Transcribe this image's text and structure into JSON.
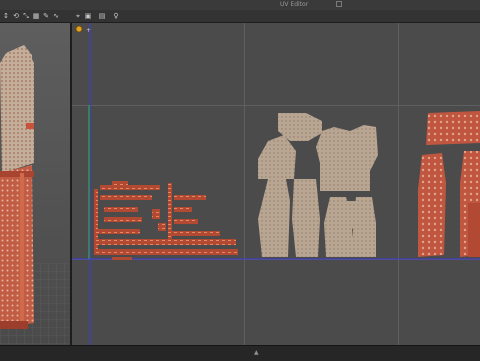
{
  "window": {
    "title": "UV Editor"
  },
  "toolbar": {
    "icons": [
      "move-icon",
      "rotate-icon",
      "scale-icon",
      "grid-icon",
      "pick-icon",
      "curve-icon",
      "snap-icon",
      "frame-icon",
      "pin-icon",
      "person-icon"
    ],
    "glyphs": [
      "↕",
      "⟲",
      "⤡",
      "▦",
      "✎",
      "∿",
      "⌖",
      "▣",
      "▤",
      "♀"
    ]
  },
  "colors": {
    "grid_line": "#5f5f5f",
    "axis_x": "#3b3bd8",
    "axis_y": "#3aa14b",
    "fabric_beige": "#b9a694",
    "fabric_red": "#c0513a",
    "fabric_dark": "#8a3322"
  }
}
